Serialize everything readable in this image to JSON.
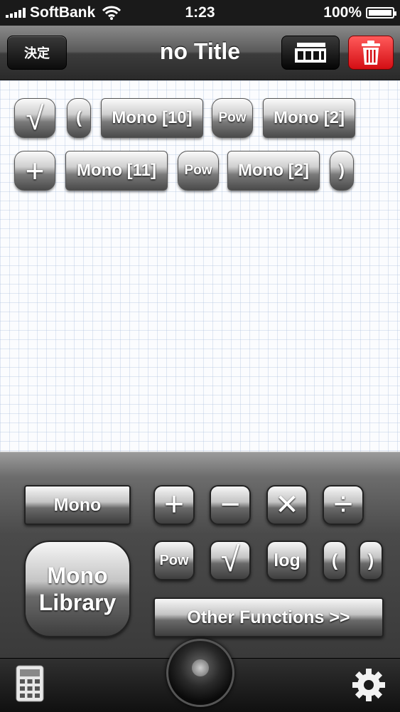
{
  "status_bar": {
    "carrier": "SoftBank",
    "time": "1:23",
    "battery": "100%"
  },
  "nav": {
    "decide_label": "決定",
    "title": "no Title",
    "gallery_icon": "gallery-icon",
    "trash_icon": "trash-icon"
  },
  "formula": {
    "row1": [
      "√",
      "(",
      "Mono [10]",
      "Pow",
      "Mono [2]"
    ],
    "row2": [
      "+",
      "Mono [11]",
      "Pow",
      "Mono [2]",
      ")"
    ]
  },
  "keypad": {
    "mono": "Mono",
    "library_line1": "Mono",
    "library_line2": "Library",
    "plus": "+",
    "minus": "−",
    "times": "✕",
    "divide": "÷",
    "pow": "Pow",
    "sqrt": "√",
    "log": "log",
    "open_paren": "(",
    "close_paren": ")",
    "other_functions": "Other Functions >>"
  },
  "colors": {
    "delete_red": "#e8141a",
    "nav_dark": "#2a2a2a",
    "grid_line": "#aabedc"
  }
}
